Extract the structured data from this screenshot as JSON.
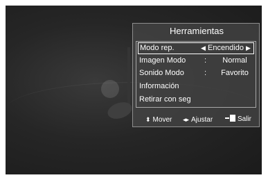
{
  "menu": {
    "title": "Herramientas",
    "items": [
      {
        "label": "Modo rep.",
        "value": "Encendido",
        "selected": true
      },
      {
        "label": "Imagen Modo",
        "colon": ":",
        "value": "Normal"
      },
      {
        "label": "Sonido Modo",
        "colon": ":",
        "value": "Favorito"
      },
      {
        "label": "Información"
      },
      {
        "label": "Retirar con seg"
      }
    ]
  },
  "hints": {
    "move_icon": "up-down-arrows-icon",
    "move": "Mover",
    "adjust_icon": "left-right-arrows-icon",
    "adjust": "Ajustar",
    "exit_icon": "exit-door-icon",
    "exit": "Salir"
  }
}
